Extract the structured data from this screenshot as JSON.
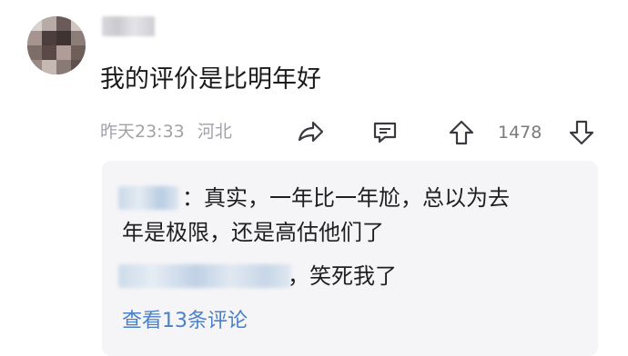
{
  "comment": {
    "text": "我的评价是比明年好",
    "time": "昨天23:33",
    "location": "河北",
    "like_count": "1478"
  },
  "replies": [
    {
      "text_line1": "：真实，一年比一年尬，总以为去",
      "text_line2": "年是极限，还是高估他们了"
    },
    {
      "text": "，笑死我了"
    }
  ],
  "view_more_label": "查看13条评论",
  "icons": [
    "share-icon",
    "reply-icon",
    "upvote-icon",
    "downvote-icon"
  ],
  "colors": {
    "link": "#4a80c8",
    "meta": "#a2a2a8",
    "reply_bg": "#f5f5f7"
  }
}
